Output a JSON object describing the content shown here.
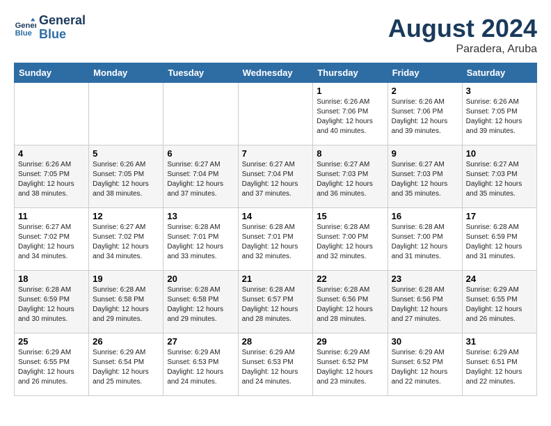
{
  "header": {
    "logo_line1": "General",
    "logo_line2": "Blue",
    "month": "August 2024",
    "location": "Paradera, Aruba"
  },
  "weekdays": [
    "Sunday",
    "Monday",
    "Tuesday",
    "Wednesday",
    "Thursday",
    "Friday",
    "Saturday"
  ],
  "weeks": [
    [
      {
        "day": "",
        "info": ""
      },
      {
        "day": "",
        "info": ""
      },
      {
        "day": "",
        "info": ""
      },
      {
        "day": "",
        "info": ""
      },
      {
        "day": "1",
        "info": "Sunrise: 6:26 AM\nSunset: 7:06 PM\nDaylight: 12 hours\nand 40 minutes."
      },
      {
        "day": "2",
        "info": "Sunrise: 6:26 AM\nSunset: 7:06 PM\nDaylight: 12 hours\nand 39 minutes."
      },
      {
        "day": "3",
        "info": "Sunrise: 6:26 AM\nSunset: 7:05 PM\nDaylight: 12 hours\nand 39 minutes."
      }
    ],
    [
      {
        "day": "4",
        "info": "Sunrise: 6:26 AM\nSunset: 7:05 PM\nDaylight: 12 hours\nand 38 minutes."
      },
      {
        "day": "5",
        "info": "Sunrise: 6:26 AM\nSunset: 7:05 PM\nDaylight: 12 hours\nand 38 minutes."
      },
      {
        "day": "6",
        "info": "Sunrise: 6:27 AM\nSunset: 7:04 PM\nDaylight: 12 hours\nand 37 minutes."
      },
      {
        "day": "7",
        "info": "Sunrise: 6:27 AM\nSunset: 7:04 PM\nDaylight: 12 hours\nand 37 minutes."
      },
      {
        "day": "8",
        "info": "Sunrise: 6:27 AM\nSunset: 7:03 PM\nDaylight: 12 hours\nand 36 minutes."
      },
      {
        "day": "9",
        "info": "Sunrise: 6:27 AM\nSunset: 7:03 PM\nDaylight: 12 hours\nand 35 minutes."
      },
      {
        "day": "10",
        "info": "Sunrise: 6:27 AM\nSunset: 7:03 PM\nDaylight: 12 hours\nand 35 minutes."
      }
    ],
    [
      {
        "day": "11",
        "info": "Sunrise: 6:27 AM\nSunset: 7:02 PM\nDaylight: 12 hours\nand 34 minutes."
      },
      {
        "day": "12",
        "info": "Sunrise: 6:27 AM\nSunset: 7:02 PM\nDaylight: 12 hours\nand 34 minutes."
      },
      {
        "day": "13",
        "info": "Sunrise: 6:28 AM\nSunset: 7:01 PM\nDaylight: 12 hours\nand 33 minutes."
      },
      {
        "day": "14",
        "info": "Sunrise: 6:28 AM\nSunset: 7:01 PM\nDaylight: 12 hours\nand 32 minutes."
      },
      {
        "day": "15",
        "info": "Sunrise: 6:28 AM\nSunset: 7:00 PM\nDaylight: 12 hours\nand 32 minutes."
      },
      {
        "day": "16",
        "info": "Sunrise: 6:28 AM\nSunset: 7:00 PM\nDaylight: 12 hours\nand 31 minutes."
      },
      {
        "day": "17",
        "info": "Sunrise: 6:28 AM\nSunset: 6:59 PM\nDaylight: 12 hours\nand 31 minutes."
      }
    ],
    [
      {
        "day": "18",
        "info": "Sunrise: 6:28 AM\nSunset: 6:59 PM\nDaylight: 12 hours\nand 30 minutes."
      },
      {
        "day": "19",
        "info": "Sunrise: 6:28 AM\nSunset: 6:58 PM\nDaylight: 12 hours\nand 29 minutes."
      },
      {
        "day": "20",
        "info": "Sunrise: 6:28 AM\nSunset: 6:58 PM\nDaylight: 12 hours\nand 29 minutes."
      },
      {
        "day": "21",
        "info": "Sunrise: 6:28 AM\nSunset: 6:57 PM\nDaylight: 12 hours\nand 28 minutes."
      },
      {
        "day": "22",
        "info": "Sunrise: 6:28 AM\nSunset: 6:56 PM\nDaylight: 12 hours\nand 28 minutes."
      },
      {
        "day": "23",
        "info": "Sunrise: 6:28 AM\nSunset: 6:56 PM\nDaylight: 12 hours\nand 27 minutes."
      },
      {
        "day": "24",
        "info": "Sunrise: 6:29 AM\nSunset: 6:55 PM\nDaylight: 12 hours\nand 26 minutes."
      }
    ],
    [
      {
        "day": "25",
        "info": "Sunrise: 6:29 AM\nSunset: 6:55 PM\nDaylight: 12 hours\nand 26 minutes."
      },
      {
        "day": "26",
        "info": "Sunrise: 6:29 AM\nSunset: 6:54 PM\nDaylight: 12 hours\nand 25 minutes."
      },
      {
        "day": "27",
        "info": "Sunrise: 6:29 AM\nSunset: 6:53 PM\nDaylight: 12 hours\nand 24 minutes."
      },
      {
        "day": "28",
        "info": "Sunrise: 6:29 AM\nSunset: 6:53 PM\nDaylight: 12 hours\nand 24 minutes."
      },
      {
        "day": "29",
        "info": "Sunrise: 6:29 AM\nSunset: 6:52 PM\nDaylight: 12 hours\nand 23 minutes."
      },
      {
        "day": "30",
        "info": "Sunrise: 6:29 AM\nSunset: 6:52 PM\nDaylight: 12 hours\nand 22 minutes."
      },
      {
        "day": "31",
        "info": "Sunrise: 6:29 AM\nSunset: 6:51 PM\nDaylight: 12 hours\nand 22 minutes."
      }
    ]
  ]
}
